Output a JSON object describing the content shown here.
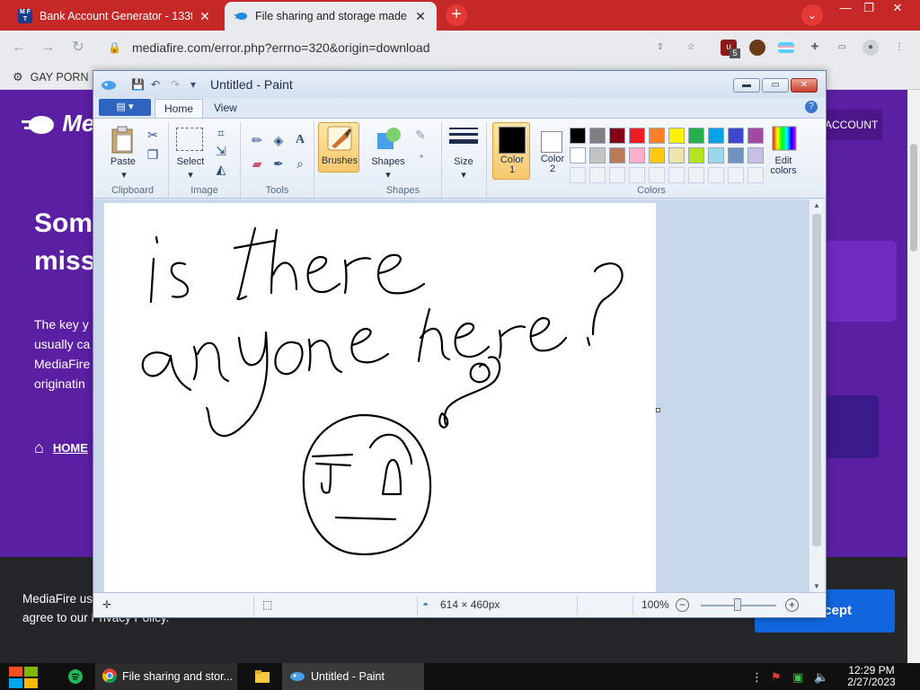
{
  "browser": {
    "tabs": [
      {
        "title": "Bank Account Generator - 133t",
        "favicon": "mft-favicon",
        "active": false
      },
      {
        "title": "File sharing and storage made s",
        "favicon": "mediafire-favicon",
        "active": true
      }
    ],
    "new_tab_icon": "+",
    "tab_menu_icon": "⌄",
    "url": "mediafire.com/error.php?errno=320&origin=download",
    "extension_badge": "5",
    "bookmark": {
      "label": "GAY PORN",
      "icon": "bookmark-page-icon"
    }
  },
  "website": {
    "logo": "Me",
    "account_button": "ACCOUNT",
    "headline_line1": "Som",
    "headline_line2": "miss",
    "body_lines": [
      "The key y",
      "usually ca",
      "MediaFire",
      "originatin"
    ],
    "home_link": "HOME",
    "cookie_line1": "MediaFire us",
    "cookie_line2": "agree to our Privacy Policy.",
    "accept_button": "cept"
  },
  "paint": {
    "title": "Untitled - Paint",
    "tabs": {
      "file_icon": "paint-menu-icon",
      "home": "Home",
      "view": "View"
    },
    "help_icon": "?",
    "groups": {
      "clipboard": "Clipboard",
      "image": "Image",
      "tools": "Tools",
      "shapes": "Shapes",
      "colors": "Colors"
    },
    "buttons": {
      "paste": "Paste",
      "select": "Select",
      "brushes": "Brushes",
      "shapes": "Shapes",
      "size": "Size",
      "color1": [
        "Color",
        "1"
      ],
      "color2": [
        "Color",
        "2"
      ],
      "edit_colors": [
        "Edit",
        "colors"
      ]
    },
    "palette_colors": [
      "#000000",
      "#7f7f7f",
      "#880015",
      "#ed1c24",
      "#ff7f27",
      "#fff200",
      "#22b14c",
      "#00a2e8",
      "#3f48cc",
      "#a349a4",
      "#ffffff",
      "#c3c3c3",
      "#b97a57",
      "#ffaec9",
      "#ffc90e",
      "#efe4b0",
      "#b5e61d",
      "#99d9ea",
      "#7092be",
      "#c8bfe7"
    ],
    "color1_value": "#000000",
    "color2_value": "#ffffff",
    "canvas_drawing": "handwritten text 'is there anyone here?' with a drawn face",
    "status": {
      "dimensions": "614 × 460px",
      "zoom": "100%"
    }
  },
  "taskbar": {
    "items": [
      {
        "label": "File sharing and stor...",
        "icon": "chrome-icon"
      },
      {
        "label": "Untitled - Paint",
        "icon": "paint-icon"
      }
    ],
    "time": "12:29 PM",
    "date": "2/27/2023"
  }
}
